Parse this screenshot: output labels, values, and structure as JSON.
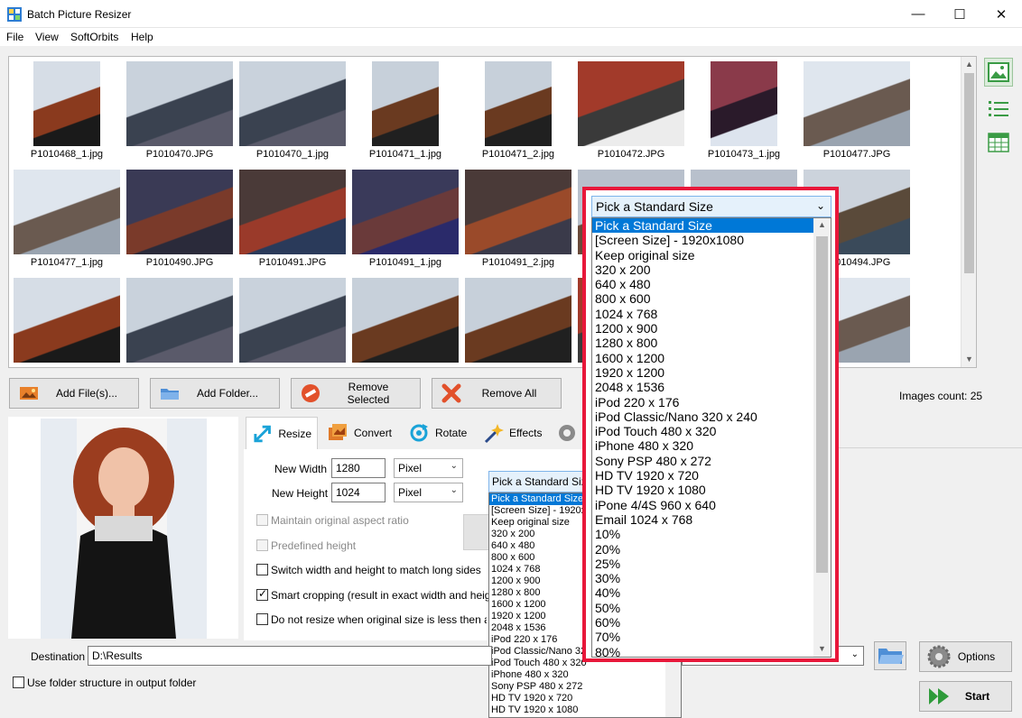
{
  "window": {
    "title": "Batch Picture Resizer",
    "minimize": "—",
    "maximize": "☐",
    "close": "✕"
  },
  "menu": [
    "File",
    "View",
    "SoftOrbits",
    "Help"
  ],
  "thumbnails": [
    "P1010468_1.jpg",
    "P1010470.JPG",
    "P1010470_1.jpg",
    "P1010471_1.jpg",
    "P1010471_2.jpg",
    "P1010472.JPG",
    "P1010473_1.jpg",
    "P1010477.JPG",
    "P1010477_1.jpg",
    "P1010490.JPG",
    "P1010491.JPG",
    "P1010491_1.jpg",
    "P1010491_2.jpg",
    "",
    "",
    "P1010494.JPG"
  ],
  "toolbar": {
    "add_files": "Add File(s)...",
    "add_folder": "Add Folder...",
    "remove_selected": "Remove Selected",
    "remove_all": "Remove All",
    "images_count": "Images count: 25"
  },
  "tabs": [
    "Resize",
    "Convert",
    "Rotate",
    "Effects"
  ],
  "resize": {
    "new_width_label": "New Width",
    "new_width_value": "1280",
    "new_width_unit": "Pixel",
    "new_height_label": "New Height",
    "new_height_value": "1024",
    "new_height_unit": "Pixel",
    "maintain_aspect": "Maintain original aspect ratio",
    "predefined_height": "Predefined height",
    "switch_sides": "Switch width and height to match long sides",
    "smart_cropping": "Smart cropping (result in exact width and height)",
    "do_not_resize": "Do not resize when original size is less then a new"
  },
  "standard_size": {
    "selected": "Pick a Standard Size",
    "small_options": [
      "Pick a Standard Size",
      "[Screen Size] - 1920x1080",
      "Keep original size",
      "320 x 200",
      "640 x 480",
      "800 x 600",
      "1024 x 768",
      "1200 x 900",
      "1280 x 800",
      "1600 x 1200",
      "1920 x 1200",
      "2048 x 1536",
      "iPod 220 x 176",
      "iPod Classic/Nano 320 x 240",
      "iPod Touch 480 x 320",
      "iPhone 480 x 320",
      "Sony PSP 480 x 272",
      "HD TV 1920 x 720",
      "HD TV 1920 x 1080",
      "iPone 4/4S 960 x 640"
    ],
    "options": [
      "Pick a Standard Size",
      "[Screen Size] - 1920x1080",
      "Keep original size",
      "320 x 200",
      "640 x 480",
      "800 x 600",
      "1024 x 768",
      "1200 x 900",
      "1280 x 800",
      "1600 x 1200",
      "1920 x 1200",
      "2048 x 1536",
      "iPod 220 x 176",
      "iPod Classic/Nano 320 x 240",
      "iPod Touch 480 x 320",
      "iPhone 480 x 320",
      "Sony PSP 480 x 272",
      "HD TV 1920 x 720",
      "HD TV 1920 x 1080",
      "iPone 4/4S 960 x 640",
      "Email 1024 x 768",
      "10%",
      "20%",
      "25%",
      "30%",
      "40%",
      "50%",
      "60%",
      "70%",
      "80%"
    ]
  },
  "destination": {
    "label": "Destination",
    "value": "D:\\Results",
    "use_folder_structure": "Use folder structure in output folder"
  },
  "buttons": {
    "options": "Options",
    "start": "Start"
  },
  "colors": {
    "highlight": "#0078d7",
    "callout_border": "#e8173a"
  }
}
